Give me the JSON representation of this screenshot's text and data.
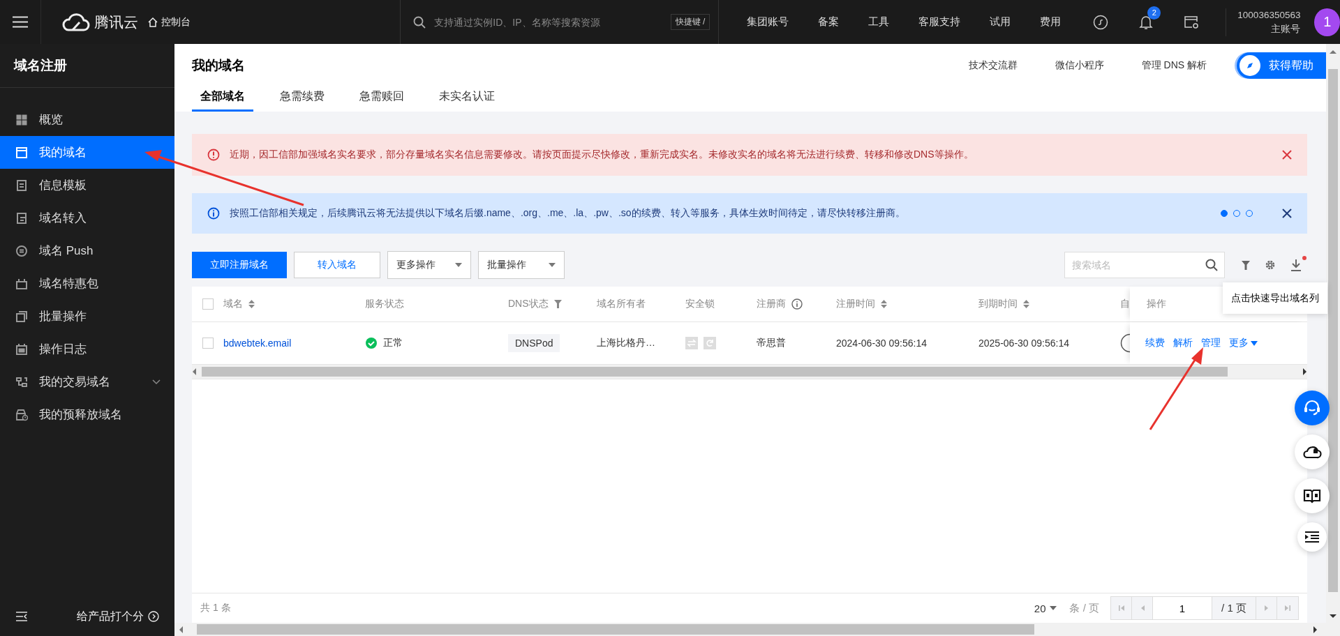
{
  "topbar": {
    "logo": "腾讯云",
    "console": "控制台",
    "search": {
      "placeholder": "支持通过实例ID、IP、名称等搜索资源",
      "shortcut": "快捷键 /"
    },
    "nav": [
      "集团账号",
      "备案",
      "工具",
      "客服支持",
      "试用",
      "费用"
    ],
    "notifications": "2",
    "account": {
      "id": "100036350563",
      "role": "主账号",
      "avatar": "1"
    }
  },
  "sidebar": {
    "title": "域名注册",
    "items": [
      {
        "label": "概览",
        "selected": false
      },
      {
        "label": "我的域名",
        "selected": true
      },
      {
        "label": "信息模板",
        "selected": false
      },
      {
        "label": "域名转入",
        "selected": false
      },
      {
        "label": "域名 Push",
        "selected": false
      },
      {
        "label": "域名特惠包",
        "selected": false
      },
      {
        "label": "批量操作",
        "selected": false
      },
      {
        "label": "操作日志",
        "selected": false
      },
      {
        "label": "我的交易域名",
        "selected": false,
        "expanded": false
      },
      {
        "label": "我的预释放域名",
        "selected": false
      }
    ],
    "footer": "给产品打个分"
  },
  "page": {
    "title": "我的域名",
    "links": [
      "技术交流群",
      "微信小程序",
      "管理 DNS 解析"
    ],
    "help_button": "获得帮助",
    "tabs": [
      {
        "label": "全部域名",
        "selected": true
      },
      {
        "label": "急需续费",
        "selected": false
      },
      {
        "label": "急需赎回",
        "selected": false
      },
      {
        "label": "未实名认证",
        "selected": false
      }
    ]
  },
  "alerts": [
    {
      "kind": "error",
      "text": "近期，因工信部加强域名实名要求，部分存量域名实名信息需要修改。请按页面提示尽快修改，重新完成实名。未修改实名的域名将无法进行续费、转移和修改DNS等操作。"
    },
    {
      "kind": "info",
      "text": "按照工信部相关规定，后续腾讯云将无法提供以下域名后缀.name、.org、.me、.la、.pw、.so的续费、转入等服务，具体生效时间待定，请尽快转移注册商。",
      "pages": [
        {
          "selected": true
        },
        {
          "selected": false
        },
        {
          "selected": false
        }
      ]
    }
  ],
  "toolbar": {
    "primary": "立即注册域名",
    "secondary": "转入域名",
    "dropdowns": [
      "更多操作",
      "批量操作"
    ],
    "search": {
      "placeholder": "搜索域名"
    },
    "tooltip": "点击快速导出域名列"
  },
  "table": {
    "select_all": {
      "checked": false
    },
    "columns": [
      {
        "label": "域名",
        "kind": "sortable"
      },
      {
        "label": "服务状态",
        "kind": "plain"
      },
      {
        "label": "DNS状态",
        "kind": "filter"
      },
      {
        "label": "域名所有者",
        "kind": "plain"
      },
      {
        "label": "安全锁",
        "kind": "plain"
      },
      {
        "label": "注册商",
        "kind": "info"
      },
      {
        "label": "注册时间",
        "kind": "sortable"
      },
      {
        "label": "到期时间",
        "kind": "sortable"
      },
      {
        "label": "自",
        "kind": "plain"
      },
      {
        "label": "操作",
        "kind": "plain"
      }
    ],
    "rows": [
      {
        "checked": false,
        "domain": "bdwebtek.email",
        "status": "正常",
        "dns": "DNSPod",
        "owner": "上海比格丹…",
        "registrar": "帝思普",
        "registered": "2024-06-30 09:56:14",
        "expires": "2025-06-30 09:56:14",
        "actions": [
          "续费",
          "解析",
          "管理",
          "更多"
        ]
      }
    ],
    "footer": {
      "total": "共 1 条",
      "page_size": "20",
      "page_size_unit": "条 / 页",
      "page": "1",
      "page_count": "/ 1 页"
    }
  }
}
